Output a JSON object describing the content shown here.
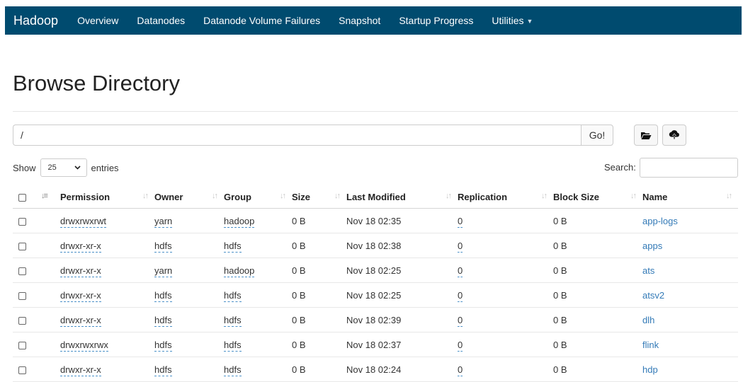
{
  "navbar": {
    "brand": "Hadoop",
    "items": [
      "Overview",
      "Datanodes",
      "Datanode Volume Failures",
      "Snapshot",
      "Startup Progress",
      "Utilities"
    ]
  },
  "page": {
    "title": "Browse Directory"
  },
  "path": {
    "value": "/",
    "go_label": "Go!"
  },
  "icons": {
    "folder": "folder-open-icon",
    "upload": "upload-icon"
  },
  "show": {
    "prefix": "Show",
    "value": "25",
    "suffix": "entries"
  },
  "search": {
    "label": "Search:",
    "value": ""
  },
  "table": {
    "headers": [
      "Permission",
      "Owner",
      "Group",
      "Size",
      "Last Modified",
      "Replication",
      "Block Size",
      "Name"
    ],
    "rows": [
      {
        "permission": "drwxrwxrwt",
        "owner": "yarn",
        "group": "hadoop",
        "size": "0 B",
        "modified": "Nov 18 02:35",
        "replication": "0",
        "block_size": "0 B",
        "name": "app-logs"
      },
      {
        "permission": "drwxr-xr-x",
        "owner": "hdfs",
        "group": "hdfs",
        "size": "0 B",
        "modified": "Nov 18 02:38",
        "replication": "0",
        "block_size": "0 B",
        "name": "apps"
      },
      {
        "permission": "drwxr-xr-x",
        "owner": "yarn",
        "group": "hadoop",
        "size": "0 B",
        "modified": "Nov 18 02:25",
        "replication": "0",
        "block_size": "0 B",
        "name": "ats"
      },
      {
        "permission": "drwxr-xr-x",
        "owner": "hdfs",
        "group": "hdfs",
        "size": "0 B",
        "modified": "Nov 18 02:25",
        "replication": "0",
        "block_size": "0 B",
        "name": "atsv2"
      },
      {
        "permission": "drwxr-xr-x",
        "owner": "hdfs",
        "group": "hdfs",
        "size": "0 B",
        "modified": "Nov 18 02:39",
        "replication": "0",
        "block_size": "0 B",
        "name": "dlh"
      },
      {
        "permission": "drwxrwxrwx",
        "owner": "hdfs",
        "group": "hdfs",
        "size": "0 B",
        "modified": "Nov 18 02:37",
        "replication": "0",
        "block_size": "0 B",
        "name": "flink"
      },
      {
        "permission": "drwxr-xr-x",
        "owner": "hdfs",
        "group": "hdfs",
        "size": "0 B",
        "modified": "Nov 18 02:24",
        "replication": "0",
        "block_size": "0 B",
        "name": "hdp"
      }
    ]
  },
  "colors": {
    "navbar": "#004b6f",
    "link": "#337ab7"
  }
}
